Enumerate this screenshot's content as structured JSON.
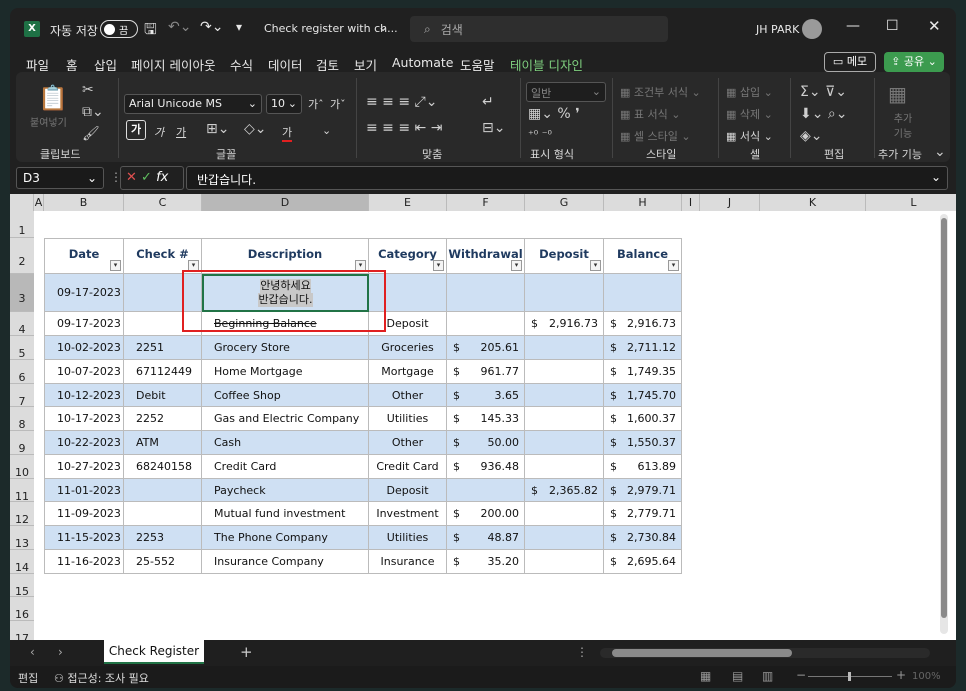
{
  "title_bar": {
    "autosave_label": "자동 저장",
    "autosave_state": "끔",
    "doc_title": "Check register with ch...",
    "search_placeholder": "검색",
    "user": "JH PARK"
  },
  "menu": {
    "tabs": [
      "파일",
      "홈",
      "삽입",
      "페이지 레이아웃",
      "수식",
      "데이터",
      "검토",
      "보기",
      "Automate",
      "도움말"
    ],
    "context_tab": "테이블 디자인",
    "memo": "메모",
    "share": "공유"
  },
  "ribbon": {
    "clipboard": {
      "paste": "붙여넣기",
      "group": "클립보드"
    },
    "font": {
      "name": "Arial Unicode MS",
      "size": "10",
      "group": "글꼴",
      "bold": "가",
      "italic": "가",
      "underline": "가",
      "fontcolor": "가",
      "grow": "가",
      "shrink": "가"
    },
    "align": {
      "group": "맞춤"
    },
    "number": {
      "format": "일반",
      "group": "표시 형식"
    },
    "styles": {
      "cond": "조건부 서식",
      "table": "표 서식",
      "cell": "셀 스타일",
      "group": "스타일"
    },
    "cells": {
      "insert": "삽입",
      "delete": "삭제",
      "format": "서식",
      "group": "셀"
    },
    "edit": {
      "group": "편집"
    },
    "addins": {
      "label": "추가 기능",
      "group": "추가 기능"
    }
  },
  "formula_bar": {
    "name_box": "D3",
    "fx": "fx",
    "content": "반갑습니다."
  },
  "columns": [
    "A",
    "B",
    "C",
    "D",
    "E",
    "F",
    "G",
    "H",
    "I",
    "J",
    "K",
    "L"
  ],
  "rows": [
    "1",
    "2",
    "3",
    "4",
    "5",
    "6",
    "7",
    "8",
    "9",
    "10",
    "11",
    "12",
    "13",
    "14",
    "15",
    "16",
    "17"
  ],
  "table": {
    "headers": [
      "Date",
      "Check #",
      "Description",
      "Category",
      "Withdrawal",
      "Deposit",
      "Balance"
    ],
    "edit_row": {
      "date": "09-17-2023",
      "line1": "안녕하세요",
      "line2": "반갑습니다."
    },
    "rows": [
      [
        "09-17-2023",
        "",
        "Beginning Balance",
        "Deposit",
        "",
        "$",
        "2,916.73",
        "$",
        "2,916.73"
      ],
      [
        "10-02-2023",
        "2251",
        "Grocery Store",
        "Groceries",
        "$",
        "205.61",
        "",
        "$",
        "2,711.12"
      ],
      [
        "10-07-2023",
        "67112449",
        "Home Mortgage",
        "Mortgage",
        "$",
        "961.77",
        "",
        "$",
        "1,749.35"
      ],
      [
        "10-12-2023",
        "Debit",
        "Coffee Shop",
        "Other",
        "$",
        "3.65",
        "",
        "$",
        "1,745.70"
      ],
      [
        "10-17-2023",
        "2252",
        "Gas and Electric Company",
        "Utilities",
        "$",
        "145.33",
        "",
        "$",
        "1,600.37"
      ],
      [
        "10-22-2023",
        "ATM",
        "Cash",
        "Other",
        "$",
        "50.00",
        "",
        "$",
        "1,550.37"
      ],
      [
        "10-27-2023",
        "68240158",
        "Credit Card",
        "Credit Card",
        "$",
        "936.48",
        "",
        "$",
        "613.89"
      ],
      [
        "11-01-2023",
        "",
        "Paycheck",
        "Deposit",
        "",
        "$",
        "2,365.82",
        "$",
        "2,979.71"
      ],
      [
        "11-09-2023",
        "",
        "Mutual fund investment",
        "Investment",
        "$",
        "200.00",
        "",
        "$",
        "2,779.71"
      ],
      [
        "11-15-2023",
        "2253",
        "The Phone Company",
        "Utilities",
        "$",
        "48.87",
        "",
        "$",
        "2,730.84"
      ],
      [
        "11-16-2023",
        "25-552",
        "Insurance Company",
        "Insurance",
        "$",
        "35.20",
        "",
        "$",
        "2,695.64"
      ]
    ]
  },
  "sheet_tab": "Check Register",
  "status": {
    "mode": "편집",
    "accessibility": "접근성: 조사 필요",
    "zoom": "100%"
  },
  "colors": {
    "accent": "#217346",
    "band": "#cfe0f3",
    "highlight": "#e02020"
  }
}
